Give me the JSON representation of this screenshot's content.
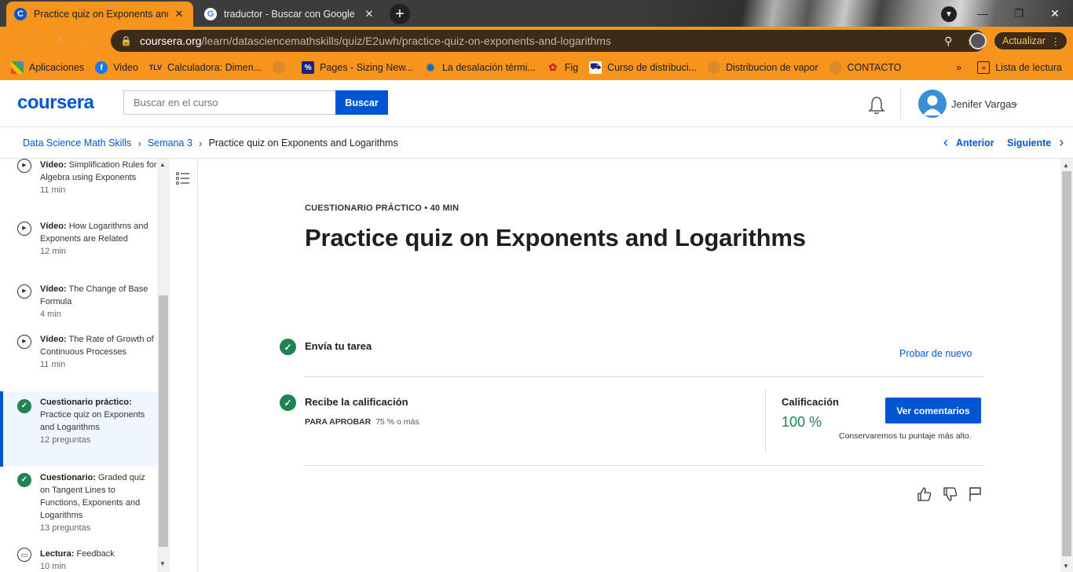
{
  "browser": {
    "tabs": [
      {
        "title": "Practice quiz on Exponents and L",
        "favicon": "C"
      },
      {
        "title": "traductor - Buscar con Google",
        "favicon": "G"
      }
    ],
    "url_host": "coursera.org",
    "url_path": "/learn/datasciencemathskills/quiz/E2uwh/practice-quiz-on-exponents-and-logarithms",
    "update_label": "Actualizar",
    "bookmarks": [
      {
        "label": "Aplicaciones",
        "icon": "apps-grid-icon"
      },
      {
        "label": "Video",
        "icon": "facebook-icon"
      },
      {
        "label": "Calculadora: Dimen...",
        "icon": "tlv-icon"
      },
      {
        "label": "",
        "icon": "globe-icon"
      },
      {
        "label": "Pages - Sizing New...",
        "icon": "pages-icon"
      },
      {
        "label": "La desalación térmi...",
        "icon": "gear-icon"
      },
      {
        "label": "Fig",
        "icon": "fig-icon"
      },
      {
        "label": "Curso de distribuci...",
        "icon": "truck-icon"
      },
      {
        "label": "Distribucion de vapor",
        "icon": "globe-icon"
      },
      {
        "label": "CONTACTO",
        "icon": "globe-icon"
      }
    ],
    "bookmarks_overflow": "»",
    "reading_list": "Lista de lectura"
  },
  "header": {
    "logo": "coursera",
    "search_placeholder": "Buscar en el curso",
    "search_button": "Buscar",
    "user_name": "Jenifer Vargas"
  },
  "breadcrumb": {
    "items": [
      "Data Science Math Skills",
      "Semana 3",
      "Practice quiz on Exponents and Logarithms"
    ],
    "prev": "Anterior",
    "next": "Siguiente"
  },
  "sidebar": {
    "items": [
      {
        "type": "Vídeo:",
        "title": "Simplification Rules for Algebra using Exponents",
        "meta": "11 min",
        "icon": "play-icon"
      },
      {
        "type": "Vídeo:",
        "title": "How Logarithms and Exponents are Related",
        "meta": "12 min",
        "icon": "play-icon"
      },
      {
        "type": "Vídeo:",
        "title": "The Change of Base Formula",
        "meta": "4 min",
        "icon": "play-icon"
      },
      {
        "type": "Vídeo:",
        "title": "The Rate of Growth of Continuous Processes",
        "meta": "11 min",
        "icon": "play-icon"
      },
      {
        "type": "Cuestionario práctico:",
        "title": "Practice quiz on Exponents and Logarithms",
        "meta": "12 preguntas",
        "icon": "check-icon",
        "active": true
      },
      {
        "type": "Cuestionario:",
        "title": "Graded quiz on Tangent Lines to Functions, Exponents and Logarithms",
        "meta": "13 preguntas",
        "icon": "check-icon"
      },
      {
        "type": "Lectura:",
        "title": "Feedback",
        "meta": "10 min",
        "icon": "book-icon"
      }
    ]
  },
  "main": {
    "kicker": "CUESTIONARIO PRÁCTICO • 40 MIN",
    "title": "Practice quiz on Exponents and Logarithms",
    "step1": "Envía tu tarea",
    "retry": "Probar de nuevo",
    "step2": "Recibe la calificación",
    "pass_label": "PARA APROBAR",
    "pass_value": "75 % o más",
    "grade_label": "Calificación",
    "grade_value": "100 %",
    "feedback_button": "Ver comentarios",
    "keep_note": "Conservaremos tu puntaje más alto."
  },
  "colors": {
    "brand": "#0056d2",
    "success": "#1f8354",
    "browser_accent": "#f7941d"
  }
}
